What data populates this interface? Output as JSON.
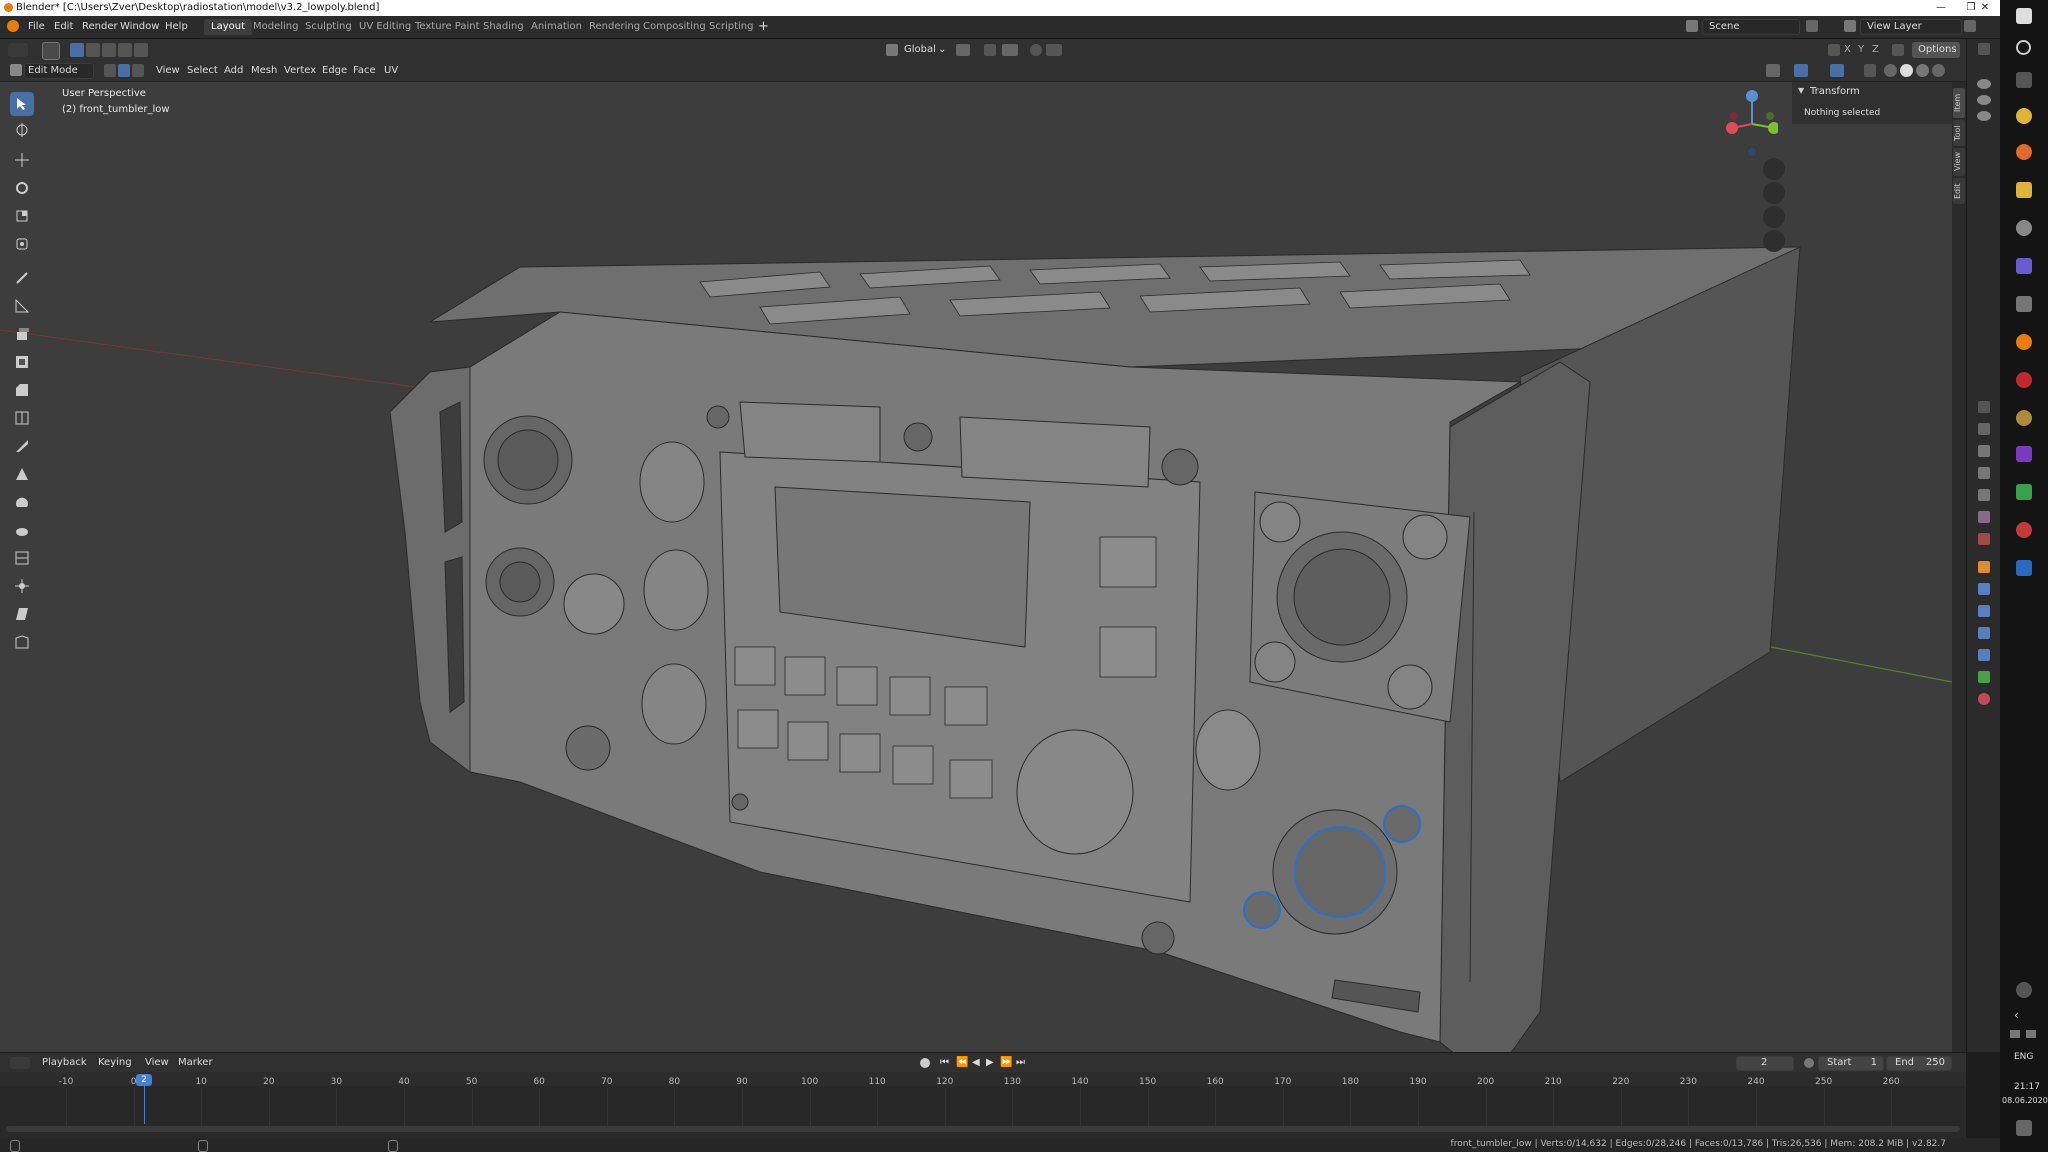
{
  "window": {
    "title": "Blender* [C:\\Users\\Zver\\Desktop\\radiostation\\model\\v3.2_lowpoly.blend]"
  },
  "menu": [
    "File",
    "Edit",
    "Render",
    "Window",
    "Help"
  ],
  "workspaces": [
    "Layout",
    "Modeling",
    "Sculpting",
    "UV Editing",
    "Texture Paint",
    "Shading",
    "Animation",
    "Rendering",
    "Compositing",
    "Scripting"
  ],
  "active_workspace": "Layout",
  "scene": {
    "label": "Scene",
    "view_layer": "View Layer"
  },
  "header": {
    "mode": "Edit Mode",
    "menus": [
      "View",
      "Select",
      "Add",
      "Mesh",
      "Vertex",
      "Edge",
      "Face",
      "UV"
    ],
    "orientation": "Global",
    "axes": [
      "X",
      "Y",
      "Z"
    ],
    "options": "Options"
  },
  "viewport": {
    "perspective": "User Perspective",
    "object": "(2) front_tumbler_low"
  },
  "npanel": {
    "section": "Transform",
    "message": "Nothing selected",
    "tabs": [
      "Item",
      "Tool",
      "View",
      "Edit"
    ]
  },
  "timeline": {
    "menus": [
      "Playback",
      "Keying",
      "View",
      "Marker"
    ],
    "current_frame": "2",
    "start_label": "Start",
    "start": "1",
    "end_label": "End",
    "end": "250",
    "ticks": [
      "-10",
      "0",
      "10",
      "20",
      "30",
      "40",
      "50",
      "60",
      "70",
      "80",
      "90",
      "100",
      "110",
      "120",
      "130",
      "140",
      "150",
      "160",
      "170",
      "180",
      "190",
      "200",
      "210",
      "220",
      "230",
      "240",
      "250",
      "260"
    ]
  },
  "status": {
    "text": "front_tumbler_low | Verts:0/14,632 | Edges:0/28,246 | Faces:0/13,786 | Tris:26,536 | Mem: 208.2 MiB | v2.82.7"
  },
  "taskbar": {
    "lang": "ENG",
    "time": "21:17",
    "date": "08.06.2020"
  },
  "colors": {
    "accent": "#4a6fa5",
    "grid_x": "#8a3a3a",
    "grid_y": "#6a8a2a"
  }
}
